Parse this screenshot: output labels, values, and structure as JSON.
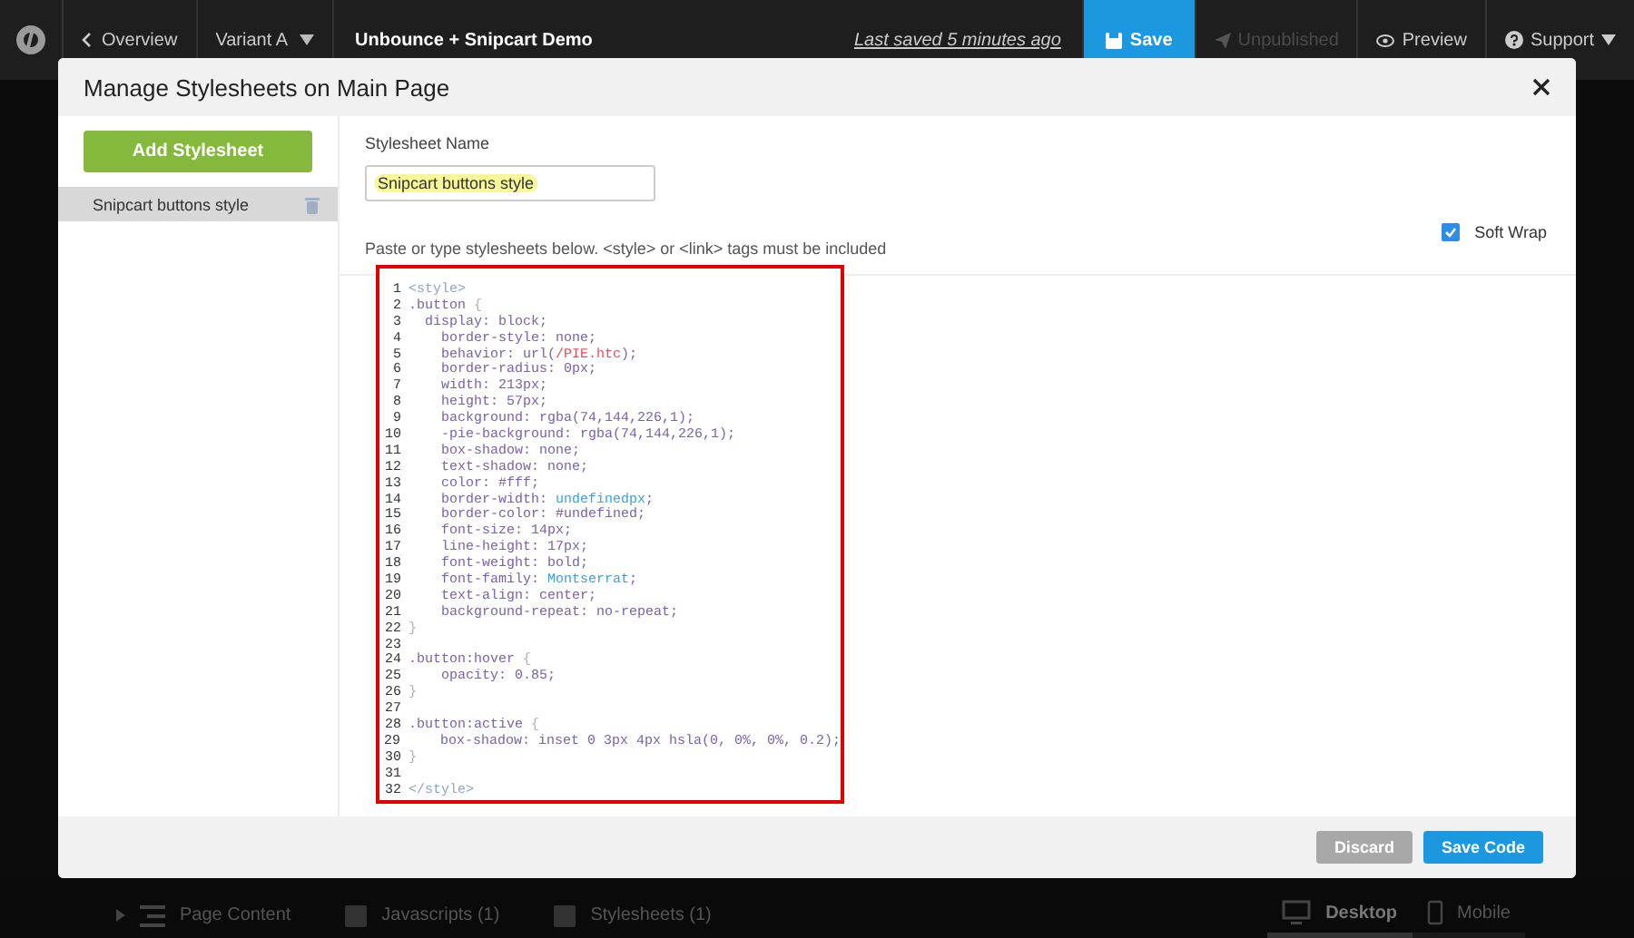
{
  "topbar": {
    "back": "Overview",
    "variant": "Variant A",
    "title": "Unbounce + Snipcart Demo",
    "last_saved": "Last saved  5 minutes ago",
    "buttons": [
      {
        "label": "Save",
        "kind": "primary",
        "disabled": false
      },
      {
        "label": "Unpublished",
        "kind": "publish",
        "disabled": true
      },
      {
        "label": "Preview",
        "kind": "preview",
        "disabled": false
      },
      {
        "label": "Support",
        "kind": "support",
        "disabled": false
      }
    ]
  },
  "modal": {
    "title": "Manage Stylesheets on Main Page",
    "add_button": "Add Stylesheet",
    "stylesheets": [
      {
        "name": "Snipcart buttons style",
        "selected": true
      }
    ],
    "name_label": "Stylesheet Name",
    "name_value": "Snipcart buttons style",
    "hint": "Paste or type stylesheets below. <style> or <link> tags must be included",
    "soft_wrap": {
      "label": "Soft Wrap",
      "checked": true
    },
    "code": [
      {
        "num": "1",
        "tokens": [
          {
            "text": "<style>",
            "kind": "tag"
          }
        ]
      },
      {
        "num": "2",
        "tokens": [
          {
            "text": ".button ",
            "kind": "plain"
          },
          {
            "text": "{",
            "kind": "brace"
          }
        ]
      },
      {
        "num": "3",
        "tokens": [
          {
            "text": "  display: block;",
            "kind": "plain"
          }
        ]
      },
      {
        "num": "4",
        "tokens": [
          {
            "text": "    border-style: none;",
            "kind": "plain"
          }
        ]
      },
      {
        "num": "5",
        "tokens": [
          {
            "text": "    behavior: url(",
            "kind": "plain"
          },
          {
            "text": "/PIE.htc",
            "kind": "string"
          },
          {
            "text": ");",
            "kind": "plain"
          }
        ]
      },
      {
        "num": "6",
        "tokens": [
          {
            "text": "    border-radius: 0px;",
            "kind": "plain"
          }
        ]
      },
      {
        "num": "7",
        "tokens": [
          {
            "text": "    width: 213px;",
            "kind": "plain"
          }
        ]
      },
      {
        "num": "8",
        "tokens": [
          {
            "text": "    height: 57px;",
            "kind": "plain"
          }
        ]
      },
      {
        "num": "9",
        "tokens": [
          {
            "text": "    background: rgba(74,144,226,1);",
            "kind": "plain"
          }
        ]
      },
      {
        "num": "10",
        "tokens": [
          {
            "text": "    -pie-background: rgba(74,144,226,1);",
            "kind": "plain"
          }
        ]
      },
      {
        "num": "11",
        "tokens": [
          {
            "text": "    box-shadow: none;",
            "kind": "plain"
          }
        ]
      },
      {
        "num": "12",
        "tokens": [
          {
            "text": "    text-shadow: none;",
            "kind": "plain"
          }
        ]
      },
      {
        "num": "13",
        "tokens": [
          {
            "text": "    color: #fff;",
            "kind": "plain"
          }
        ]
      },
      {
        "num": "14",
        "tokens": [
          {
            "text": "    border-width: ",
            "kind": "plain"
          },
          {
            "text": "undefinedpx",
            "kind": "atom"
          },
          {
            "text": ";",
            "kind": "plain"
          }
        ]
      },
      {
        "num": "15",
        "tokens": [
          {
            "text": "    border-color: #undefined;",
            "kind": "plain"
          }
        ]
      },
      {
        "num": "16",
        "tokens": [
          {
            "text": "    font-size: 14px;",
            "kind": "plain"
          }
        ]
      },
      {
        "num": "17",
        "tokens": [
          {
            "text": "    line-height: 17px;",
            "kind": "plain"
          }
        ]
      },
      {
        "num": "18",
        "tokens": [
          {
            "text": "    font-weight: bold;",
            "kind": "plain"
          }
        ]
      },
      {
        "num": "19",
        "tokens": [
          {
            "text": "    font-family: ",
            "kind": "plain"
          },
          {
            "text": "Montserrat",
            "kind": "atom"
          },
          {
            "text": ";",
            "kind": "plain"
          }
        ]
      },
      {
        "num": "20",
        "tokens": [
          {
            "text": "    text-align: center;",
            "kind": "plain"
          }
        ]
      },
      {
        "num": "21",
        "tokens": [
          {
            "text": "    background-repeat: no-repeat;",
            "kind": "plain"
          }
        ]
      },
      {
        "num": "22",
        "tokens": [
          {
            "text": "}",
            "kind": "brace"
          }
        ]
      },
      {
        "num": "23"
      },
      {
        "num": "24",
        "tokens": [
          {
            "text": ".button:hover ",
            "kind": "plain"
          },
          {
            "text": "{",
            "kind": "brace"
          }
        ]
      },
      {
        "num": "25",
        "tokens": [
          {
            "text": "    opacity: 0.85;",
            "kind": "plain"
          }
        ]
      },
      {
        "num": "26",
        "tokens": [
          {
            "text": "}",
            "kind": "brace"
          }
        ]
      },
      {
        "num": "27"
      },
      {
        "num": "28",
        "tokens": [
          {
            "text": ".button:active ",
            "kind": "plain"
          },
          {
            "text": "{",
            "kind": "brace"
          }
        ]
      },
      {
        "num": "29",
        "tokens": [
          {
            "text": "    box-shadow: inset 0 3px 4px hsla(0, 0%, 0%, 0.2);",
            "kind": "plain"
          }
        ]
      },
      {
        "num": "30",
        "tokens": [
          {
            "text": "}",
            "kind": "brace"
          }
        ]
      },
      {
        "num": "31"
      },
      {
        "num": "32",
        "tokens": [
          {
            "text": "</style>",
            "kind": "tag"
          }
        ]
      }
    ],
    "footer_buttons": [
      {
        "label": "Discard",
        "kind": "secondary"
      },
      {
        "label": "Save Code",
        "kind": "primary"
      }
    ]
  },
  "bottombar": {
    "items": [
      {
        "label": "Page Content",
        "kind": "content"
      },
      {
        "label": "Javascripts (1)",
        "kind": "js"
      },
      {
        "label": "Stylesheets (1)",
        "kind": "css"
      }
    ],
    "devices": [
      {
        "label": "Desktop",
        "kind": "desktop",
        "selected": true
      },
      {
        "label": "Mobile",
        "kind": "mobile",
        "selected": false
      }
    ]
  }
}
